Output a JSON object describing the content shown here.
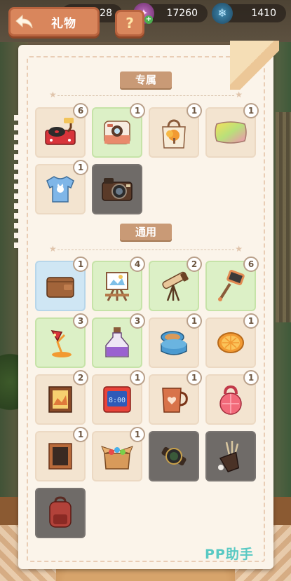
{
  "header": {
    "back_label": "礼物",
    "help_label": "?"
  },
  "resources": [
    {
      "name": "coins",
      "value": "28"
    },
    {
      "name": "gems",
      "value": "17260"
    },
    {
      "name": "snowflakes",
      "value": "1410"
    }
  ],
  "sections": {
    "exclusive": "专属",
    "general": "通用"
  },
  "exclusive_items": [
    {
      "name": "record-player",
      "count": "6",
      "bg": "cream"
    },
    {
      "name": "instant-camera",
      "count": "1",
      "bg": "green"
    },
    {
      "name": "tote-bag",
      "count": "1",
      "bg": "cream"
    },
    {
      "name": "pillow",
      "count": "1",
      "bg": "cream"
    },
    {
      "name": "t-shirt",
      "count": "1",
      "bg": "cream"
    },
    {
      "name": "retro-camera",
      "count": "",
      "bg": "grey"
    }
  ],
  "general_items": [
    {
      "name": "wallet",
      "count": "1",
      "bg": "blue"
    },
    {
      "name": "easel",
      "count": "4",
      "bg": "green"
    },
    {
      "name": "telescope",
      "count": "2",
      "bg": "green"
    },
    {
      "name": "selfie-stick",
      "count": "6",
      "bg": "green"
    },
    {
      "name": "desk-lamp",
      "count": "3",
      "bg": "green"
    },
    {
      "name": "potion-bottle",
      "count": "3",
      "bg": "green"
    },
    {
      "name": "cookie-tin",
      "count": "1",
      "bg": "cream"
    },
    {
      "name": "orange-slice",
      "count": "1",
      "bg": "cream"
    },
    {
      "name": "photo-frame",
      "count": "2",
      "bg": "cream"
    },
    {
      "name": "digital-clock",
      "count": "1",
      "bg": "cream"
    },
    {
      "name": "heart-mug",
      "count": "1",
      "bg": "cream"
    },
    {
      "name": "kettlebell",
      "count": "1",
      "bg": "cream"
    },
    {
      "name": "blackboard",
      "count": "1",
      "bg": "cream"
    },
    {
      "name": "toy-box",
      "count": "1",
      "bg": "cream"
    },
    {
      "name": "watch",
      "count": "",
      "bg": "grey"
    },
    {
      "name": "golf-bag",
      "count": "",
      "bg": "grey"
    },
    {
      "name": "backpack",
      "count": "",
      "bg": "grey"
    }
  ],
  "clock_text": "8:00",
  "watermark": "PP助手"
}
